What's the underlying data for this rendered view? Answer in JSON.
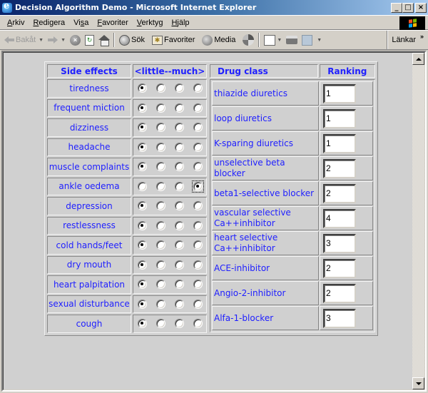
{
  "window": {
    "title": "Decision Algorithm Demo - Microsoft Internet Explorer",
    "buttons": {
      "minimize": "_",
      "maximize": "□",
      "close": "×"
    }
  },
  "menu": [
    {
      "label": "Arkiv",
      "accel": "A"
    },
    {
      "label": "Redigera",
      "accel": "R"
    },
    {
      "label": "Visa",
      "accel": "s"
    },
    {
      "label": "Favoriter",
      "accel": "F"
    },
    {
      "label": "Verktyg",
      "accel": "V"
    },
    {
      "label": "Hjälp",
      "accel": "H"
    }
  ],
  "toolbar": {
    "back": "Bakåt",
    "search": "Sök",
    "favorites": "Favoriter",
    "media": "Media",
    "links": "Länkar",
    "links_chevron": "»"
  },
  "side_effects": {
    "header": "Side effects",
    "scale_header": "<little--much>",
    "levels": 4,
    "items": [
      {
        "label": "tiredness",
        "selected": 0
      },
      {
        "label": "frequent miction",
        "selected": 0
      },
      {
        "label": "dizziness",
        "selected": 0
      },
      {
        "label": "headache",
        "selected": 0
      },
      {
        "label": "muscle complaints",
        "selected": 0
      },
      {
        "label": "ankle oedema",
        "selected": 3,
        "focused": true
      },
      {
        "label": "depression",
        "selected": 0
      },
      {
        "label": "restlessness",
        "selected": 0
      },
      {
        "label": "cold hands/feet",
        "selected": 0
      },
      {
        "label": "dry mouth",
        "selected": 0
      },
      {
        "label": "heart palpitation",
        "selected": 0
      },
      {
        "label": "sexual disturbance",
        "selected": 0
      },
      {
        "label": "cough",
        "selected": 0
      }
    ]
  },
  "drugs": {
    "header_class": "Drug class",
    "header_ranking": "Ranking",
    "items": [
      {
        "label": "thiazide diuretics",
        "ranking": "1"
      },
      {
        "label": "loop diuretics",
        "ranking": "1"
      },
      {
        "label": "K-sparing diuretics",
        "ranking": "1"
      },
      {
        "label": "unselective beta blocker",
        "ranking": "2"
      },
      {
        "label": "beta1-selective blocker",
        "ranking": "2"
      },
      {
        "label": "vascular selective Ca++inhibitor",
        "ranking": "4"
      },
      {
        "label": "heart selective Ca++inhibitor",
        "ranking": "3"
      },
      {
        "label": "ACE-inhibitor",
        "ranking": "2"
      },
      {
        "label": "Angio-2-inhibitor",
        "ranking": "2"
      },
      {
        "label": "Alfa-1-blocker",
        "ranking": "3"
      }
    ]
  },
  "colors": {
    "link_text": "#2020ff",
    "page_bg": "#d0d0d0",
    "chrome": "#d4d0c8",
    "titlebar_start": "#0a246a",
    "titlebar_end": "#a6caf0"
  }
}
